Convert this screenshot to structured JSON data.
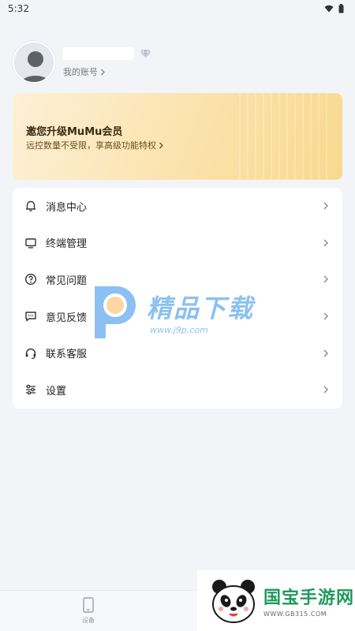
{
  "status_bar": {
    "time": "5:32"
  },
  "profile": {
    "account_label": "我的账号"
  },
  "vip_card": {
    "title": "邀您升级MuMu会员",
    "subtitle": "远控数量不受限，享高级功能特权"
  },
  "menu": {
    "items": [
      {
        "label": "消息中心",
        "icon": "bell-icon"
      },
      {
        "label": "终端管理",
        "icon": "monitor-icon"
      },
      {
        "label": "常见问题",
        "icon": "question-icon"
      },
      {
        "label": "意见反馈",
        "icon": "feedback-icon"
      },
      {
        "label": "联系客服",
        "icon": "headset-icon"
      },
      {
        "label": "设置",
        "icon": "sliders-icon"
      }
    ]
  },
  "watermark": {
    "title": "精品下载",
    "url": "www.j9p.com"
  },
  "tabbar": {
    "device_label": "设备"
  },
  "badge": {
    "title": "国宝手游网",
    "url": "WWW.GB315.COM"
  },
  "colors": {
    "accent_gold": "#fbe1a8",
    "watermark_blue": "#2f8ee8",
    "badge_green": "#1d9a5b"
  }
}
